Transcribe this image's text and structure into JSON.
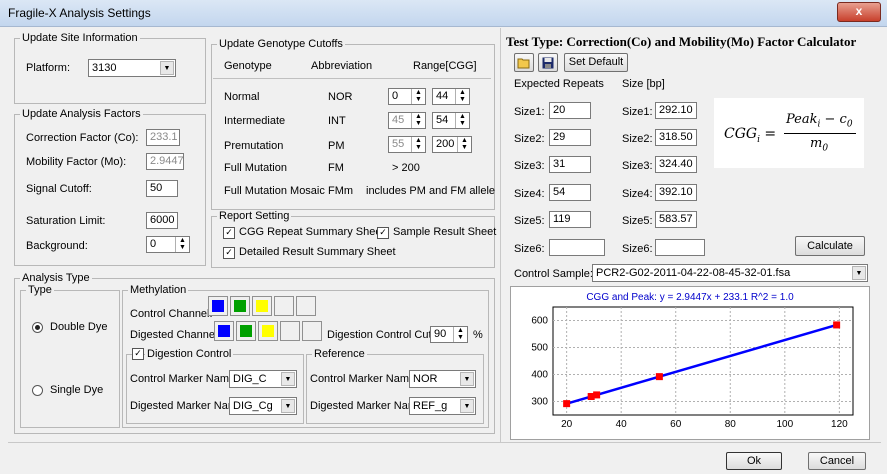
{
  "window": {
    "title": "Fragile-X Analysis Settings",
    "close_glyph": "x"
  },
  "site": {
    "group_label": "Update Site Information",
    "platform_label": "Platform:",
    "platform_value": "3130"
  },
  "factors": {
    "group_label": "Update Analysis Factors",
    "correction_label": "Correction Factor (Co):",
    "correction_value": "233.1",
    "mobility_label": "Mobility Factor (Mo):",
    "mobility_value": "2.9447",
    "signal_label": "Signal Cutoff:",
    "signal_value": "50",
    "saturation_label": "Saturation Limit:",
    "saturation_value": "6000",
    "background_label": "Background:",
    "background_value": "0"
  },
  "cutoffs": {
    "group_label": "Update Genotype Cutoffs",
    "headers": [
      "Genotype",
      "Abbreviation",
      "Range[CGG]"
    ],
    "rows": [
      {
        "name": "Normal",
        "abbr": "NOR",
        "low": "0",
        "high": "44"
      },
      {
        "name": "Intermediate",
        "abbr": "INT",
        "low": "45",
        "high": "54"
      },
      {
        "name": "Premutation",
        "abbr": "PM",
        "low": "55",
        "high": "200"
      },
      {
        "name": "Full Mutation",
        "abbr": "FM",
        "range": "> 200"
      },
      {
        "name": "Full Mutation Mosaic",
        "abbr": "FMm",
        "range": "includes PM and FM allele"
      }
    ]
  },
  "report": {
    "group_label": "Report Setting",
    "cgg_label": "CGG Repeat Summary Sheet",
    "sample_label": "Sample Result Sheet",
    "detailed_label": "Detailed Result Summary Sheet"
  },
  "analysis": {
    "group_label": "Analysis Type",
    "type_label": "Type",
    "double_dye": "Double Dye",
    "single_dye": "Single Dye",
    "methylation_label": "Methylation",
    "control_channel_label": "Control Channel:",
    "digested_channel_label": "Digested Channel:",
    "channel_colors": [
      "#0000ff",
      "#00a000",
      "#ffff00"
    ],
    "cutoff_label": "Digestion Control Cutoff:",
    "cutoff_value": "90",
    "percent": "%",
    "digestion_control_label": "Digestion Control",
    "control_marker_label": "Control Marker Name:",
    "control_marker_value": "DIG_C",
    "digested_marker_label": "Digested Marker Name:",
    "digested_marker_value": "DIG_Cg",
    "reference_label": "Reference",
    "ref_control_label": "Control Marker Name:",
    "ref_control_value": "NOR",
    "ref_digested_label": "Digested Marker Name:",
    "ref_digested_value": "REF_g"
  },
  "calculator": {
    "title": "Test Type: Correction(Co) and Mobility(Mo) Factor Calculator",
    "set_default": "Set Default",
    "expected_label": "Expected Repeats",
    "size_label": "Size [bp]",
    "repeat_labels": [
      "Size1:",
      "Size2:",
      "Size3:",
      "Size4:",
      "Size5:",
      "Size6:"
    ],
    "repeats": [
      "20",
      "29",
      "31",
      "54",
      "119",
      ""
    ],
    "bp_labels": [
      "Size1:",
      "Size2:",
      "Size3:",
      "Size4:",
      "Size5:",
      "Size6:"
    ],
    "bp": [
      "292.10",
      "318.50",
      "324.40",
      "392.10",
      "583.57",
      ""
    ],
    "calculate": "Calculate",
    "control_sample_label": "Control Sample:",
    "control_sample_value": "PCR2-G02-2011-04-22-08-45-32-01.fsa",
    "formula_lhs": "CGG",
    "formula_sub": "i",
    "formula_num": "Peak",
    "formula_c": "c",
    "formula_m": "m",
    "formula_zero": "0"
  },
  "chart_data": {
    "type": "scatter",
    "title": "CGG and Peak: y = 2.9447x + 233.1   R^2 = 1.0",
    "x": [
      20,
      29,
      31,
      54,
      119
    ],
    "y": [
      292.1,
      318.5,
      324.4,
      392.1,
      583.57
    ],
    "fit": {
      "slope": 2.9447,
      "intercept": 233.1
    },
    "xlim": [
      15,
      125
    ],
    "ylim": [
      250,
      650
    ],
    "xticks": [
      20,
      40,
      60,
      80,
      100,
      120
    ],
    "yticks": [
      300,
      400,
      500,
      600
    ],
    "grid": true,
    "line_color": "#0000ff",
    "point_color": "#ff0000"
  },
  "footer": {
    "ok": "Ok",
    "cancel": "Cancel"
  }
}
